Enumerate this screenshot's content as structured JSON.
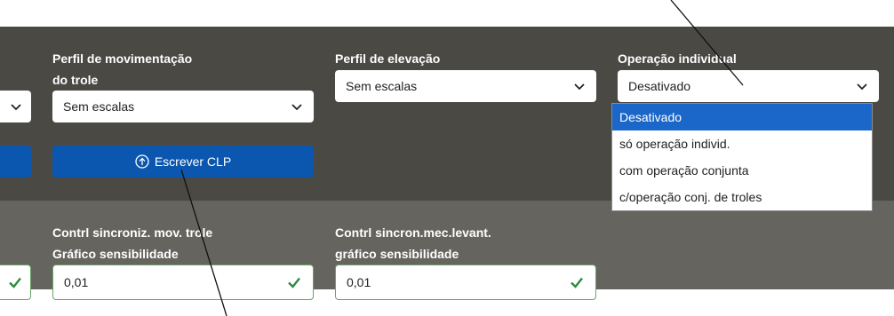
{
  "left_partial": {
    "select_value": "",
    "input_value": ""
  },
  "col1": {
    "label_line1": "Perfil de movimentação",
    "label_line2": "do trole",
    "select_value": "Sem escalas",
    "button_label": "Escrever CLP",
    "field_label_line1": "Contrl sincroniz. mov. trole",
    "field_label_line2": "Gráfico sensibilidade",
    "field_value": "0,01"
  },
  "col2": {
    "label": "Perfil de elevação",
    "select_value": "Sem escalas",
    "field_label_line1": "Contrl sincron.mec.levant.",
    "field_label_line2": "gráfico sensibilidade",
    "field_value": "0,01"
  },
  "col3": {
    "label": "Operação individual",
    "select_value": "Desativado",
    "options": [
      "Desativado",
      "só operação individ.",
      "com operação conjunta",
      "c/operação conj. de troles"
    ],
    "selected_index": 0
  },
  "colors": {
    "primary_button": "#0b57b0",
    "selected_option": "#1a66c9",
    "valid_check": "#2e8b3d",
    "panel_dark": "#4a4944",
    "panel_mid": "#65645e"
  },
  "icons": {
    "chevron": "chevron-down-icon",
    "upload": "arrow-up-circle-icon",
    "check": "checkmark-icon"
  }
}
